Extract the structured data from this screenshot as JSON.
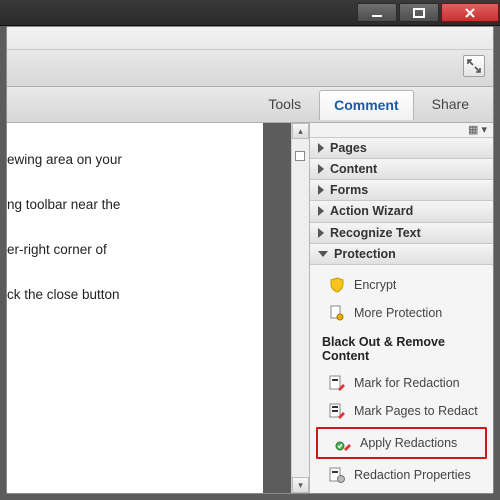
{
  "window": {
    "min_tip": "Minimize",
    "max_tip": "Maximize",
    "close_tip": "Close"
  },
  "app": {
    "inner_close": "×"
  },
  "tabs": {
    "tools": "Tools",
    "comment": "Comment",
    "share": "Share"
  },
  "panel": {
    "options_glyph": "▦ ▾",
    "sections": {
      "pages": "Pages",
      "content": "Content",
      "forms": "Forms",
      "action_wizard": "Action Wizard",
      "recognize_text": "Recognize Text",
      "protection": "Protection"
    },
    "protection": {
      "encrypt": "Encrypt",
      "more_protection": "More Protection",
      "subheader": "Black Out & Remove Content",
      "mark_for_redaction": "Mark for Redaction",
      "mark_pages_to_redact": "Mark Pages to Redact",
      "apply_redactions": "Apply Redactions",
      "redaction_properties": "Redaction Properties"
    }
  },
  "document": {
    "lines": [
      "ewing area on your",
      "ng toolbar near the",
      "er-right corner of",
      "ck the close button"
    ]
  }
}
